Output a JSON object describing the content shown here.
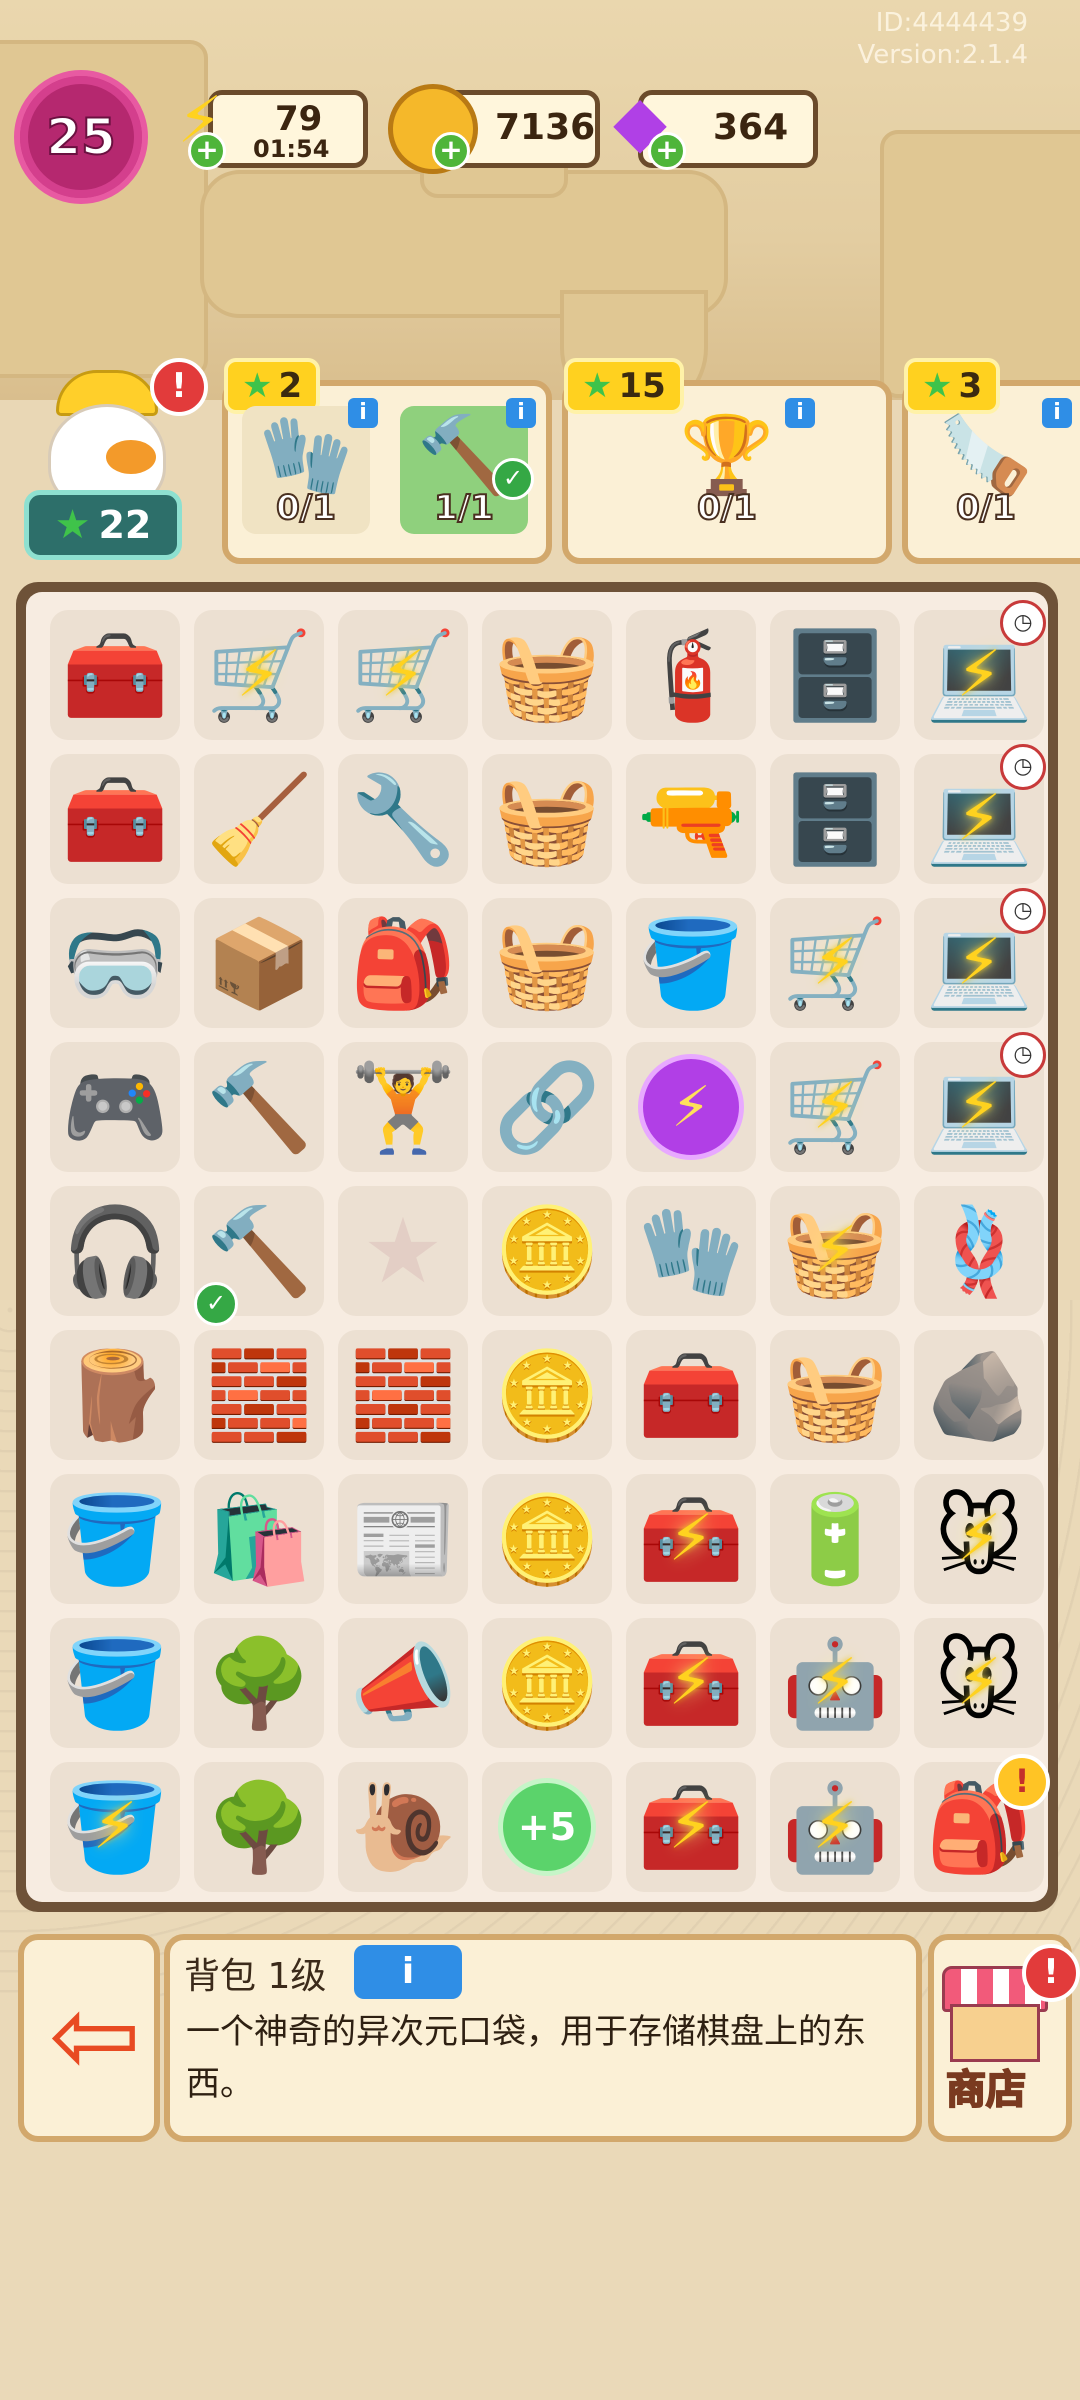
{
  "header": {
    "user_id": "ID:4444439",
    "version": "Version:2.1.4",
    "level": "25",
    "energy": {
      "value": "79",
      "timer": "01:54",
      "icon": "lightning-icon"
    },
    "coins": {
      "value": "7136",
      "icon": "coin-icon"
    },
    "gems": {
      "value": "364",
      "icon": "gem-icon"
    }
  },
  "character": {
    "level": "22",
    "alert": "!"
  },
  "orders": [
    {
      "reward": "2",
      "items": [
        {
          "name": "gloves",
          "icon": "🧤",
          "progress": "0/1",
          "done": false
        },
        {
          "name": "hammer",
          "icon": "🔨",
          "progress": "1/1",
          "done": true
        }
      ]
    },
    {
      "reward": "15",
      "items": [
        {
          "name": "trophy",
          "icon": "🏆",
          "progress": "0/1",
          "done": false
        }
      ]
    },
    {
      "reward": "3",
      "items": [
        {
          "name": "saw",
          "icon": "🪚",
          "progress": "0/1",
          "done": false
        }
      ]
    }
  ],
  "board": [
    [
      {
        "i": "🧰",
        "n": "toolbox-pile"
      },
      {
        "i": "🛒",
        "n": "wheelbarrow",
        "b": 1
      },
      {
        "i": "🛒",
        "n": "cart",
        "b": 1
      },
      {
        "i": "🧺",
        "n": "basket-dumbbell"
      },
      {
        "i": "🧯",
        "n": "drill-rope"
      },
      {
        "i": "🗄️",
        "n": "cabinet"
      },
      {
        "i": "💻",
        "n": "laptop",
        "b": 1,
        "c": 1
      }
    ],
    [
      {
        "i": "🧰",
        "n": "toolbox-pile"
      },
      {
        "i": "🧹",
        "n": "dustpan"
      },
      {
        "i": "🔧",
        "n": "grip-trainer"
      },
      {
        "i": "🧺",
        "n": "basket"
      },
      {
        "i": "🔫",
        "n": "drill"
      },
      {
        "i": "🗄️",
        "n": "cabinet"
      },
      {
        "i": "💻",
        "n": "laptop",
        "b": 1,
        "c": 1
      }
    ],
    [
      {
        "i": "🥽",
        "n": "vr-headset"
      },
      {
        "i": "📦",
        "n": "tool-box"
      },
      {
        "i": "🎒",
        "n": "kettlebell"
      },
      {
        "i": "🧺",
        "n": "basket-frame"
      },
      {
        "i": "🪣",
        "n": "bin"
      },
      {
        "i": "🛒",
        "n": "cart-gold",
        "b": 1
      },
      {
        "i": "💻",
        "n": "laptop",
        "b": 1,
        "c": 1
      }
    ],
    [
      {
        "i": "🎮",
        "n": "game-console"
      },
      {
        "i": "🔨",
        "n": "mallet"
      },
      {
        "i": "🏋️",
        "n": "dumbbell"
      },
      {
        "i": "🔗",
        "n": "chest-expander"
      },
      {
        "i": "orb",
        "n": "energy-orb"
      },
      {
        "i": "🛒",
        "n": "cart-gold",
        "b": 1
      },
      {
        "i": "💻",
        "n": "laptop",
        "b": 1,
        "c": 1
      }
    ],
    [
      {
        "i": "🎧",
        "n": "headphones"
      },
      {
        "i": "🔨",
        "n": "hammer",
        "ck": 1
      },
      {
        "i": "star",
        "n": "empty-slot"
      },
      {
        "i": "🪙",
        "n": "coin-stack"
      },
      {
        "i": "🧤",
        "n": "gloves"
      },
      {
        "i": "🧺",
        "n": "basket-gold",
        "b": 1
      },
      {
        "i": "🪢",
        "n": "rope"
      }
    ],
    [
      {
        "i": "🪵",
        "n": "wood-chunk"
      },
      {
        "i": "🧱",
        "n": "bricks"
      },
      {
        "i": "🧱",
        "n": "brick-pair"
      },
      {
        "i": "🪙",
        "n": "coin-pile"
      },
      {
        "i": "🧰",
        "n": "green-toolbox"
      },
      {
        "i": "🧺",
        "n": "wicker-basket"
      },
      {
        "i": "🪨",
        "n": "stone"
      }
    ],
    [
      {
        "i": "🪣",
        "n": "bucket"
      },
      {
        "i": "🛍️",
        "n": "sack"
      },
      {
        "i": "📰",
        "n": "magazine"
      },
      {
        "i": "🪙",
        "n": "coin-double"
      },
      {
        "i": "🧰",
        "n": "toolbox-open",
        "b": 1
      },
      {
        "i": "🔋",
        "n": "capacitor"
      },
      {
        "i": "🐭",
        "n": "statue",
        "b": 1
      }
    ],
    [
      {
        "i": "🪣",
        "n": "plaster-bucket"
      },
      {
        "i": "🌳",
        "n": "potted-tree"
      },
      {
        "i": "📣",
        "n": "megaphone"
      },
      {
        "i": "🪙",
        "n": "coin"
      },
      {
        "i": "🧰",
        "n": "toolbox-case",
        "b": 1
      },
      {
        "i": "🤖",
        "n": "robot-vacuum",
        "b": 1
      },
      {
        "i": "🐭",
        "n": "statue",
        "b": 1
      }
    ],
    [
      {
        "i": "🪣",
        "n": "bucket-gold",
        "b": 1
      },
      {
        "i": "🌳",
        "n": "potted-tree"
      },
      {
        "i": "🐌",
        "n": "snail-cat"
      },
      {
        "i": "plus5",
        "n": "energy-plus5"
      },
      {
        "i": "🧰",
        "n": "toolbox-case",
        "b": 1
      },
      {
        "i": "🤖",
        "n": "robot-vacuum",
        "b": 1
      },
      {
        "i": "🎒",
        "n": "backpack",
        "a": 1
      }
    ]
  ],
  "plus5_label": "+5",
  "description": {
    "title": "背包 1级",
    "info_label": "i",
    "text": "一个神奇的异次元口袋，用于存储棋盘上的东西。"
  },
  "shop": {
    "label": "商店",
    "alert": "!"
  },
  "colors": {
    "accent": "#2f8ee6",
    "reward": "#ffd11f",
    "board_frame": "#6e5238"
  }
}
